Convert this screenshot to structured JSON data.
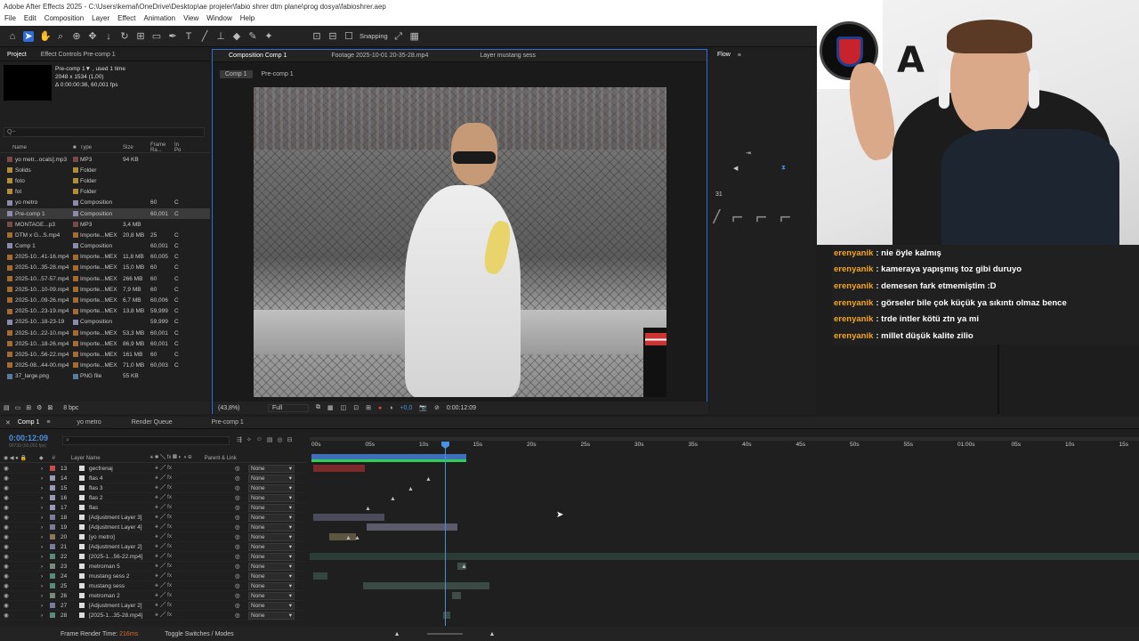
{
  "window": {
    "title": "Adobe After Effects 2025 - C:\\Users\\kemal\\OneDrive\\Desktop\\ae projeler\\fabio shrer dtm plane\\prog dosya\\fabioshrer.aep"
  },
  "menu": [
    "File",
    "Edit",
    "Composition",
    "Layer",
    "Effect",
    "Animation",
    "View",
    "Window",
    "Help"
  ],
  "toolbar": {
    "snapping_label": "Snapping"
  },
  "project": {
    "tab_label": "Project",
    "effect_controls_label": "Effect Controls Pre-comp 1",
    "selected": {
      "name": "Pre-comp 1▼ , used 1 time",
      "dims": "2048 x 1534 (1,00)",
      "duration": "Δ 0:00:00:36, 60,001 fps"
    },
    "search_placeholder": "Q~",
    "columns": {
      "name": "Name",
      "type": "Type",
      "size": "Size",
      "rate": "Frame Ra...",
      "in": "In Po"
    },
    "items": [
      {
        "name": "yo metr...ocals].mp3",
        "type": "MP3",
        "size": "94 KB",
        "rate": "",
        "in": "",
        "color": "#7a4a4a"
      },
      {
        "name": "Solids",
        "type": "Folder",
        "size": "",
        "rate": "",
        "in": "",
        "color": "#b08d3a"
      },
      {
        "name": "foto",
        "type": "Folder",
        "size": "",
        "rate": "",
        "in": "",
        "color": "#b08d3a"
      },
      {
        "name": "fot",
        "type": "Folder",
        "size": "",
        "rate": "",
        "in": "",
        "color": "#b08d3a"
      },
      {
        "name": "yo metro",
        "type": "Composition",
        "size": "",
        "rate": "60",
        "in": "C",
        "color": "#8a8aaa"
      },
      {
        "name": "Pre-comp 1",
        "type": "Composition",
        "size": "",
        "rate": "60,001",
        "in": "C",
        "color": "#8a8aaa"
      },
      {
        "name": "MONTAGE...p3",
        "type": "MP3",
        "size": "3,4 MB",
        "rate": "",
        "in": "",
        "color": "#7a4a4a"
      },
      {
        "name": "DTM x G...S.mp4",
        "type": "Importe...MEX",
        "size": "20,8 MB",
        "rate": "25",
        "in": "C",
        "color": "#a36b2f"
      },
      {
        "name": "Comp 1",
        "type": "Composition",
        "size": "",
        "rate": "60,001",
        "in": "C",
        "color": "#8a8aaa"
      },
      {
        "name": "2025-10...41-16.mp4",
        "type": "Importe...MEX",
        "size": "11,8 MB",
        "rate": "60,005",
        "in": "C",
        "color": "#a36b2f"
      },
      {
        "name": "2025-10...35-28.mp4",
        "type": "Importe...MEX",
        "size": "15,0 MB",
        "rate": "60",
        "in": "C",
        "color": "#a36b2f"
      },
      {
        "name": "2025-10...57-57.mp4",
        "type": "Importe...MEX",
        "size": "266 MB",
        "rate": "60",
        "in": "C",
        "color": "#a36b2f"
      },
      {
        "name": "2025-10...10-09.mp4",
        "type": "Importe...MEX",
        "size": "7,9 MB",
        "rate": "60",
        "in": "C",
        "color": "#a36b2f"
      },
      {
        "name": "2025-10...09-26.mp4",
        "type": "Importe...MEX",
        "size": "6,7 MB",
        "rate": "60,006",
        "in": "C",
        "color": "#a36b2f"
      },
      {
        "name": "2025-10...23-19.mp4",
        "type": "Importe...MEX",
        "size": "13,8 MB",
        "rate": "59,999",
        "in": "C",
        "color": "#a36b2f"
      },
      {
        "name": "2025-10...18-23-19",
        "type": "Composition",
        "size": "",
        "rate": "59,999",
        "in": "C",
        "color": "#8a8aaa"
      },
      {
        "name": "2025-10...22-10.mp4",
        "type": "Importe...MEX",
        "size": "53,3 MB",
        "rate": "60,001",
        "in": "C",
        "color": "#a36b2f"
      },
      {
        "name": "2025-10...18-26.mp4",
        "type": "Importe...MEX",
        "size": "86,9 MB",
        "rate": "60,001",
        "in": "C",
        "color": "#a36b2f"
      },
      {
        "name": "2025-10...56-22.mp4",
        "type": "Importe...MEX",
        "size": "161 MB",
        "rate": "60",
        "in": "C",
        "color": "#a36b2f"
      },
      {
        "name": "2025-08...44-00.mp4",
        "type": "Importe...MEX",
        "size": "71,0 MB",
        "rate": "60,003",
        "in": "C",
        "color": "#a36b2f"
      },
      {
        "name": "37_large.png",
        "type": "PNG file",
        "size": "55 KB",
        "rate": "",
        "in": "",
        "color": "#5a7a9a"
      }
    ],
    "bpc": "8 bpc"
  },
  "composition": {
    "tabs": [
      "Composition Comp 1",
      "Footage 2025-10-01 20-35-28.mp4",
      "Layer mustang sess"
    ],
    "breadcrumbs": [
      "Comp 1",
      "Pre-comp 1"
    ],
    "zoom": "(43,8%)",
    "resolution": "Full",
    "exposure": "+0,0",
    "timecode": "0:00:12:09"
  },
  "flow": {
    "tab_label": "Flow",
    "value": "31"
  },
  "chat": [
    {
      "user": "erenyanik",
      "msg": ": nie öyle kalmış"
    },
    {
      "user": "erenyanik",
      "msg": ": kameraya yapışmış toz gibi duruyo"
    },
    {
      "user": "erenyanik",
      "msg": ": demesen fark etmemiştim :D"
    },
    {
      "user": "erenyanik",
      "msg": ": görseler bile çok küçük ya sıkıntı olmaz bence"
    },
    {
      "user": "erenyanik",
      "msg": ": trde intler kötü ztn ya mi"
    },
    {
      "user": "erenyanik",
      "msg": ": millet düşük kalite zilio"
    }
  ],
  "timeline": {
    "tabs": [
      "Comp 1",
      "yo metro",
      "Render Queue",
      "Pre-comp 1"
    ],
    "timecode": "0:00:12:09",
    "sub_timecode": "00739 (60,001 fps)",
    "columns": {
      "hash": "#",
      "layer_name": "Layer Name",
      "parent": "Parent & Link"
    },
    "ruler": [
      "00s",
      "05s",
      "10s",
      "15s",
      "20s",
      "25s",
      "30s",
      "35s",
      "40s",
      "45s",
      "50s",
      "55s",
      "01:00s",
      "05s",
      "10s",
      "15s"
    ],
    "layers": [
      {
        "num": "13",
        "name": "gecfrenaj",
        "parent": "None",
        "color": "#c84a4a"
      },
      {
        "num": "14",
        "name": "flas 4",
        "parent": "None",
        "color": "#9a9ab4"
      },
      {
        "num": "15",
        "name": "flas 3",
        "parent": "None",
        "color": "#9a9ab4"
      },
      {
        "num": "16",
        "name": "flas 2",
        "parent": "None",
        "color": "#9a9ab4"
      },
      {
        "num": "17",
        "name": "flas",
        "parent": "None",
        "color": "#9a9ab4"
      },
      {
        "num": "18",
        "name": "[Adjustment Layer 3]",
        "parent": "None",
        "color": "#7a7a9a"
      },
      {
        "num": "19",
        "name": "[Adjustment Layer 4]",
        "parent": "None",
        "color": "#7a7a9a"
      },
      {
        "num": "20",
        "name": "[yo metro]",
        "parent": "None",
        "color": "#8a7a5a"
      },
      {
        "num": "21",
        "name": "[Adjustment Layer 2]",
        "parent": "None",
        "color": "#7a7a9a"
      },
      {
        "num": "22",
        "name": "[2025-1...56-22.mp4]",
        "parent": "None",
        "color": "#5a8a7a"
      },
      {
        "num": "23",
        "name": "metroman 5",
        "parent": "None",
        "color": "#7a8a7a"
      },
      {
        "num": "24",
        "name": "mustang sess 2",
        "parent": "None",
        "color": "#5a8a7a"
      },
      {
        "num": "25",
        "name": "mustang sess",
        "parent": "None",
        "color": "#5a8a7a"
      },
      {
        "num": "26",
        "name": "metroman 2",
        "parent": "None",
        "color": "#7a8a7a"
      },
      {
        "num": "27",
        "name": "[Adjustment Layer 2]",
        "parent": "None",
        "color": "#7a7a9a"
      },
      {
        "num": "28",
        "name": "[2025-1...35-28.mp4]",
        "parent": "None",
        "color": "#5a8a7a"
      }
    ],
    "frame_render_label": "Frame Render Time:",
    "frame_render_value": "216ms",
    "toggle_label": "Toggle Switches / Modes"
  }
}
